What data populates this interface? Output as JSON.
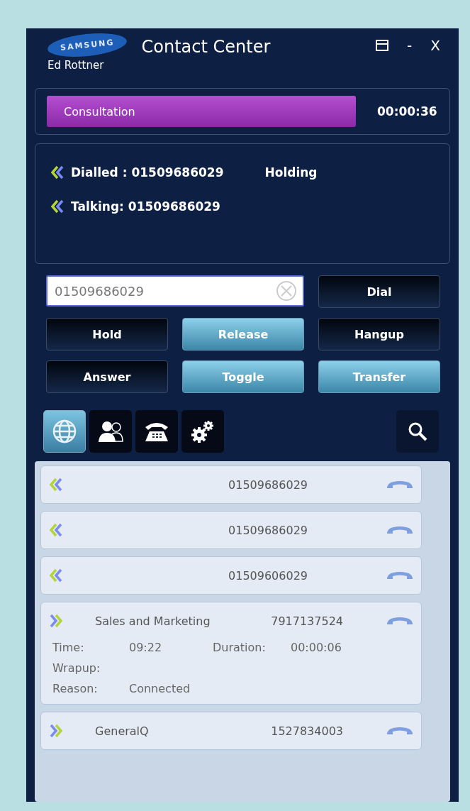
{
  "window": {
    "title": "Contact Center",
    "logo": "SAMSUNG",
    "user": "Ed Rottner",
    "controls": [
      "-",
      "X"
    ]
  },
  "status": {
    "state": "Consultation",
    "timer": "00:00:36"
  },
  "calls": [
    {
      "kind": "incoming",
      "label": "Dialled : 01509686029",
      "state": "Holding"
    },
    {
      "kind": "incoming",
      "label": "Talking:  01509686029"
    }
  ],
  "dial_field": {
    "value": "01509686029"
  },
  "buttons": [
    {
      "label": "Dial",
      "lit": false
    },
    {
      "label": "Hold",
      "lit": false
    },
    {
      "label": "Release",
      "lit": true
    },
    {
      "label": "Hangup",
      "lit": false
    },
    {
      "label": "Answer",
      "lit": false
    },
    {
      "label": "Toggle",
      "lit": true
    },
    {
      "label": "Transfer",
      "lit": true
    }
  ],
  "tabs": [
    {
      "kind": "globe",
      "selected": true
    },
    {
      "kind": "contacts",
      "selected": false
    },
    {
      "kind": "phone",
      "selected": false
    },
    {
      "kind": "settings",
      "selected": false
    }
  ],
  "history": [
    {
      "kind": "incoming",
      "number": "01509686029"
    },
    {
      "kind": "incoming",
      "number": "01509686029"
    },
    {
      "kind": "incoming",
      "number": "01509606029"
    },
    {
      "kind": "outgoing",
      "name": "Sales and Marketing",
      "number": "7917137524",
      "details": [
        [
          {
            "label": "Time:",
            "value": "09:22"
          },
          {
            "label": "Duration:",
            "value": "00:00:06"
          }
        ],
        [
          {
            "label": "Wrapup:"
          }
        ],
        [
          {
            "label": "Reason:",
            "value": "Connected"
          }
        ]
      ]
    },
    {
      "kind": "outgoing",
      "name": "GeneralQ",
      "number": "1527834003"
    }
  ]
}
